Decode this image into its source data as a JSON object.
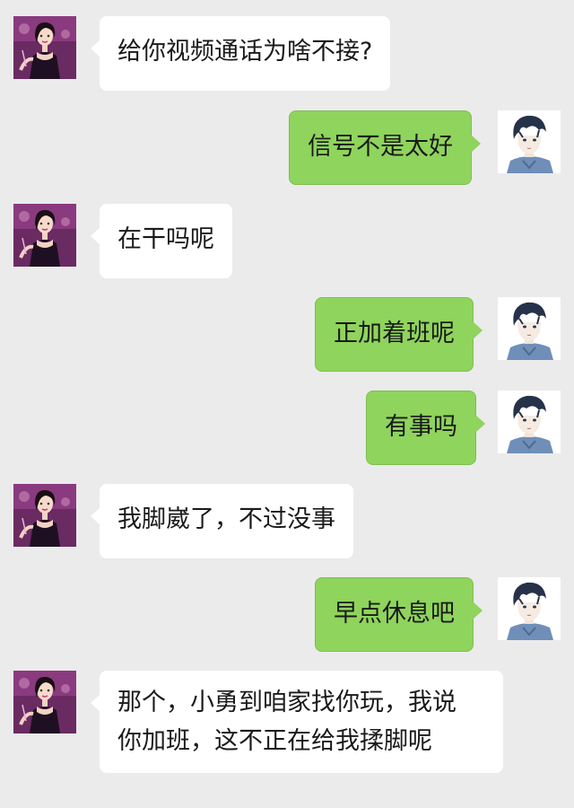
{
  "colors": {
    "background": "#ebebeb",
    "incoming_bubble": "#ffffff",
    "outgoing_bubble": "#8fd45c"
  },
  "messages": [
    {
      "sender": "contact",
      "avatar": "woman-avatar",
      "lines": [
        "给你视频通话为啥不接?"
      ]
    },
    {
      "sender": "me",
      "avatar": "man-avatar",
      "lines": [
        "信号不是太好"
      ]
    },
    {
      "sender": "contact",
      "avatar": "woman-avatar",
      "lines": [
        "在干吗呢"
      ]
    },
    {
      "sender": "me",
      "avatar": "man-avatar",
      "lines": [
        "正加着班呢"
      ]
    },
    {
      "sender": "me",
      "avatar": "man-avatar",
      "lines": [
        "有事吗"
      ]
    },
    {
      "sender": "contact",
      "avatar": "woman-avatar",
      "lines": [
        "我脚崴了，不过没事"
      ]
    },
    {
      "sender": "me",
      "avatar": "man-avatar",
      "lines": [
        "早点休息吧"
      ]
    },
    {
      "sender": "contact",
      "avatar": "woman-avatar",
      "lines": [
        "那个，小勇到咱家找你玩，我说",
        "你加班，这不正在给我揉脚呢"
      ]
    }
  ]
}
